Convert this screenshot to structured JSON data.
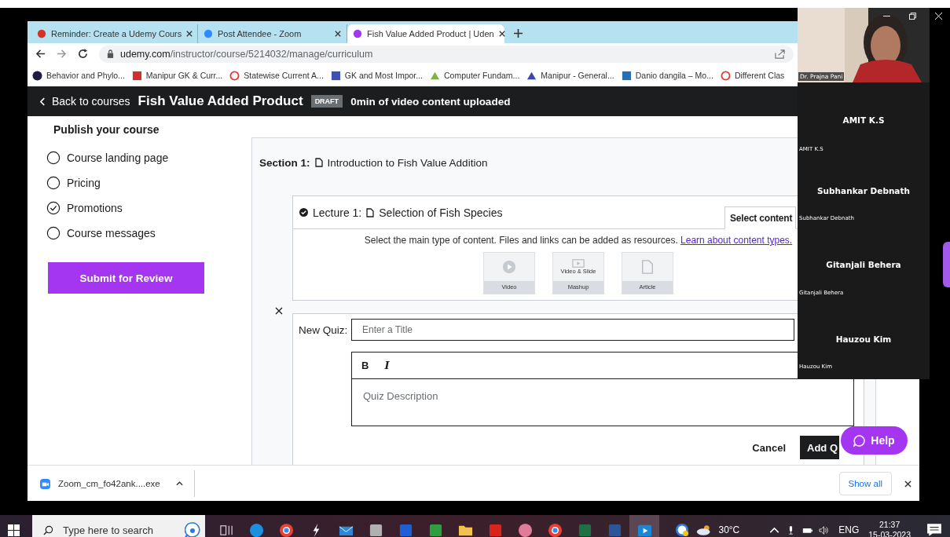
{
  "browser": {
    "tabs": [
      {
        "kind": "mail",
        "title": "Reminder: Create a Udemy Cours",
        "selected": false
      },
      {
        "kind": "zoom",
        "title": "Post Attendee - Zoom",
        "selected": false
      },
      {
        "kind": "udemy",
        "title": "Fish Value Added Product | Uden",
        "selected": true
      }
    ],
    "url_domain": "udemy.com",
    "url_path": "/instructor/course/5214032/manage/curriculum",
    "bookmarks": [
      {
        "kind": "circle",
        "label": "Behavior and Phylo..."
      },
      {
        "kind": "flag",
        "label": "Manipur GK & Curr..."
      },
      {
        "kind": "ring",
        "label": "Statewise Current A..."
      },
      {
        "kind": "square",
        "label": "GK and Most Impor..."
      },
      {
        "kind": "leaf",
        "label": "Computer Fundam..."
      },
      {
        "kind": "mountain",
        "label": "Manipur - General..."
      },
      {
        "kind": "tile",
        "label": "Danio dangila – Mo..."
      },
      {
        "kind": "target",
        "label": "Different Clas"
      }
    ]
  },
  "course_header": {
    "back": "Back to courses",
    "title": "Fish Value Added Product",
    "badge": "DRAFT",
    "status": "0min of video content uploaded"
  },
  "sidebar": {
    "heading": "Publish your course",
    "items": [
      {
        "label": "Course landing page",
        "checked": false
      },
      {
        "label": "Pricing",
        "checked": false
      },
      {
        "label": "Promotions",
        "checked": true
      },
      {
        "label": "Course messages",
        "checked": false
      }
    ],
    "submit": "Submit for Review"
  },
  "curriculum": {
    "section_label": "Section 1:",
    "section_title": "Introduction to Fish Value Addition",
    "lecture": {
      "label": "Lecture 1:",
      "title": "Selection of Fish Species",
      "select_button": "Select content",
      "hint": "Select the main type of content. Files and links can be added as resources.",
      "link": "Learn about content types.",
      "content_types": [
        {
          "kind": "video",
          "label": "Video"
        },
        {
          "kind": "mashup",
          "caption": "Video & Slide",
          "label": "Mashup"
        },
        {
          "kind": "article",
          "label": "Article"
        }
      ]
    },
    "quiz": {
      "label": "New Quiz:",
      "title_placeholder": "Enter a Title",
      "bold": "B",
      "italic": "I",
      "description_placeholder": "Quiz Description",
      "cancel": "Cancel",
      "add": "Add Q"
    }
  },
  "download_bar": {
    "file": "Zoom_cm_fo42ank....exe",
    "show_all": "Show all"
  },
  "help": "Help",
  "zoom": {
    "speaker": "Dr. Prajna Pani",
    "participants": [
      {
        "name": "AMIT K.S",
        "label": "AMIT K.S"
      },
      {
        "name": "Subhankar Debnath",
        "label": "Subhankar Debnath"
      },
      {
        "name": "Gitanjali Behera",
        "label": "Gitanjali Behera"
      },
      {
        "name": "Hauzou Kim",
        "label": "Hauzou Kim"
      }
    ]
  },
  "taskbar": {
    "search_placeholder": "Type here to search",
    "apps": [
      {
        "kind": "task-view",
        "active": false
      },
      {
        "kind": "edge",
        "active": false
      },
      {
        "kind": "chrome",
        "active": false
      },
      {
        "kind": "bolt",
        "active": false
      },
      {
        "kind": "mail",
        "active": false
      },
      {
        "kind": "scanner",
        "active": false
      },
      {
        "kind": "dropbox",
        "active": false
      },
      {
        "kind": "camtasia",
        "active": false
      },
      {
        "kind": "folder",
        "active": false
      },
      {
        "kind": "acrobat",
        "active": false
      },
      {
        "kind": "snip",
        "active": false
      },
      {
        "kind": "chrome",
        "active": false
      },
      {
        "kind": "excel",
        "active": false
      },
      {
        "kind": "word",
        "active": false
      },
      {
        "kind": "media",
        "active": true
      }
    ],
    "temperature": "30°C",
    "language": "ENG",
    "time": "21:37",
    "date": "15-03-2023"
  }
}
